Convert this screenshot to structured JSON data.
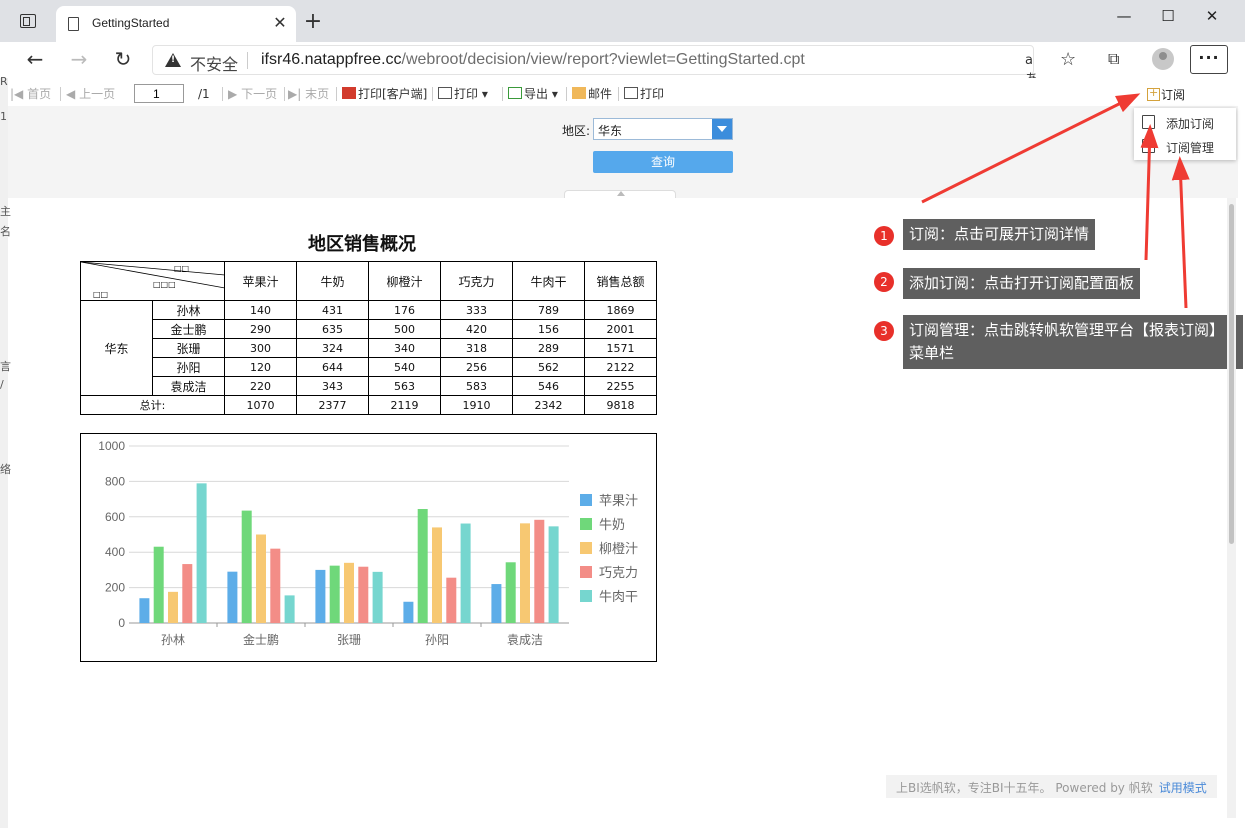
{
  "browser": {
    "tab_title": "GettingStarted",
    "security_label": "不安全",
    "url_host": "ifsr46.natappfree.cc",
    "url_path": "/webroot/decision/view/report?viewlet=GettingStarted.cpt",
    "read_aloud_label": "aあ",
    "window_controls": [
      "—",
      "☐",
      "✕"
    ],
    "menu_label": "···"
  },
  "left_strip_fragments": [
    "R",
    "1",
    "主",
    "名",
    "言",
    "/",
    "络"
  ],
  "toolbar": {
    "first_page": "首页",
    "prev_page": "上一页",
    "current_page": "1",
    "total_pages": "/1",
    "next_page": "下一页",
    "last_page": "末页",
    "print_client": "打印[客户端]",
    "print": "打印",
    "export": "导出",
    "mail": "邮件",
    "print2": "打印",
    "subscribe": "订阅"
  },
  "subscribe_menu": {
    "add": "添加订阅",
    "manage": "订阅管理"
  },
  "params": {
    "area_label": "地区:",
    "area_value": "华东",
    "query_button": "查询"
  },
  "annotations": [
    {
      "num": "1",
      "text": "订阅：点击可展开订阅详情"
    },
    {
      "num": "2",
      "text": "添加订阅：点击打开订阅配置面板"
    },
    {
      "num": "3",
      "text": "订阅管理：点击跳转帆软管理平台【报表订阅】菜单栏"
    }
  ],
  "report": {
    "title": "地区销售概况",
    "diag_labels": [
      "□□",
      "□□□",
      "□□"
    ],
    "columns": [
      "苹果汁",
      "牛奶",
      "柳橙汁",
      "巧克力",
      "牛肉干",
      "销售总额"
    ],
    "region": "华东",
    "rows": [
      {
        "name": "孙林",
        "values": [
          "140",
          "431",
          "176",
          "333",
          "789",
          "1869"
        ]
      },
      {
        "name": "金士鹏",
        "values": [
          "290",
          "635",
          "500",
          "420",
          "156",
          "2001"
        ]
      },
      {
        "name": "张珊",
        "values": [
          "300",
          "324",
          "340",
          "318",
          "289",
          "1571"
        ]
      },
      {
        "name": "孙阳",
        "values": [
          "120",
          "644",
          "540",
          "256",
          "562",
          "2122"
        ]
      },
      {
        "name": "袁成洁",
        "values": [
          "220",
          "343",
          "563",
          "583",
          "546",
          "2255"
        ]
      }
    ],
    "total_label": "总计:",
    "totals": [
      "1070",
      "2377",
      "2119",
      "1910",
      "2342",
      "9818"
    ]
  },
  "chart_data": {
    "type": "bar",
    "categories": [
      "孙林",
      "金士鹏",
      "张珊",
      "孙阳",
      "袁成洁"
    ],
    "series": [
      {
        "name": "苹果汁",
        "color": "#5dade8",
        "values": [
          140,
          290,
          300,
          120,
          220
        ]
      },
      {
        "name": "牛奶",
        "color": "#6fd87a",
        "values": [
          431,
          635,
          324,
          644,
          343
        ]
      },
      {
        "name": "柳橙汁",
        "color": "#f7c872",
        "values": [
          176,
          500,
          340,
          540,
          563
        ]
      },
      {
        "name": "巧克力",
        "color": "#f38d87",
        "values": [
          333,
          420,
          318,
          256,
          583
        ]
      },
      {
        "name": "牛肉干",
        "color": "#76d6cf",
        "values": [
          789,
          156,
          289,
          562,
          546
        ]
      }
    ],
    "title": "",
    "xlabel": "",
    "ylabel": "",
    "ylim": [
      0,
      1000
    ],
    "yticks": [
      0,
      200,
      400,
      600,
      800,
      1000
    ],
    "grid": true,
    "legend": "right"
  },
  "footer": {
    "text": "上BI选帆软，专注BI十五年。 Powered by 帆软",
    "trial": "试用模式"
  }
}
